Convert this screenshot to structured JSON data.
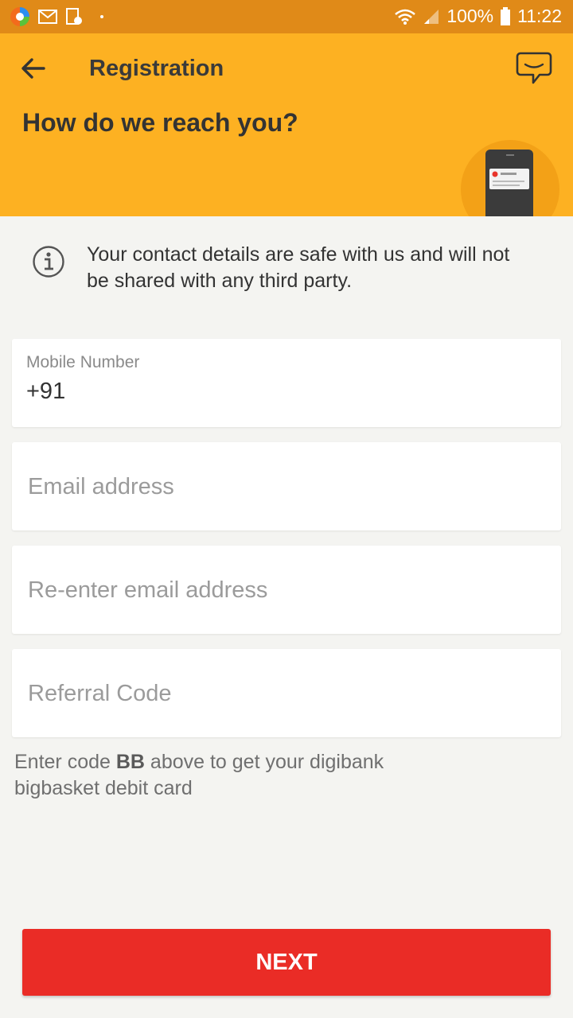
{
  "status_bar": {
    "battery_percent": "100%",
    "time": "11:22",
    "icons": [
      "browser-app-icon",
      "gmail-icon",
      "screenshot-icon",
      "wifi-icon",
      "signal-icon",
      "battery-icon"
    ]
  },
  "header": {
    "title": "Registration",
    "subtitle": "How do we reach you?",
    "icons": [
      "back-arrow-icon",
      "chat-icon"
    ],
    "background_color": "#fdb122"
  },
  "info": {
    "text": "Your contact details are safe with us and will not be shared with any third party.",
    "icon": "info-icon"
  },
  "form": {
    "mobile": {
      "label": "Mobile Number",
      "value": "+91"
    },
    "email": {
      "placeholder": "Email address"
    },
    "reenter_email": {
      "placeholder": "Re-enter email address"
    },
    "referral": {
      "placeholder": "Referral Code"
    }
  },
  "hint": {
    "prefix": "Enter code ",
    "code": "BB",
    "suffix": " above to get your digibank bigbasket debit card"
  },
  "actions": {
    "next_label": "NEXT",
    "next_color": "#ea2c26"
  }
}
